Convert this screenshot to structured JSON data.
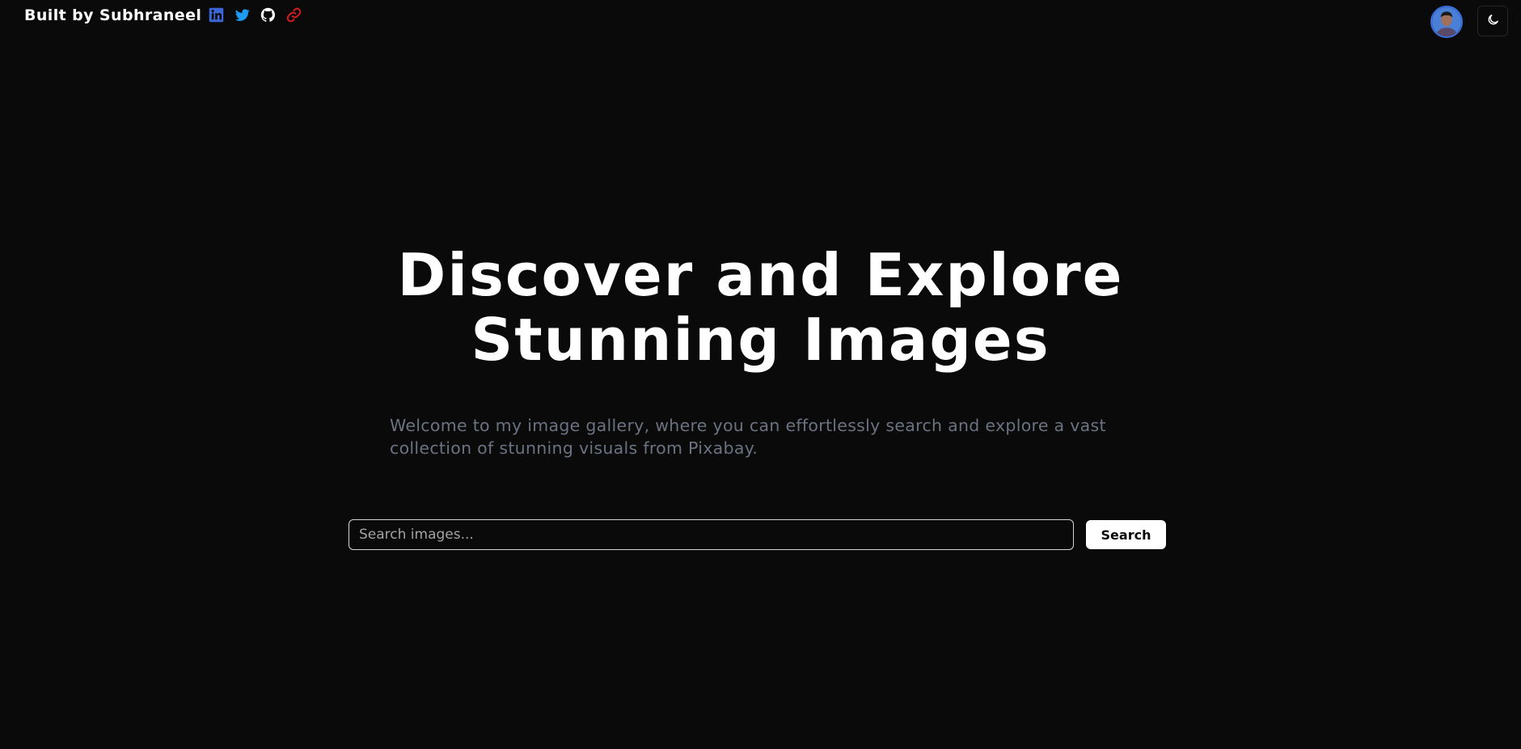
{
  "header": {
    "brand": "Built by Subhraneel",
    "socials": [
      {
        "icon": "linkedin-icon",
        "color": "#3b66d6"
      },
      {
        "icon": "twitter-icon",
        "color": "#1d9bf0"
      },
      {
        "icon": "github-icon",
        "color": "#ffffff"
      },
      {
        "icon": "link-icon",
        "color": "#c81e1e"
      }
    ],
    "avatar_icon": "avatar",
    "theme_toggle_icon": "moon-icon"
  },
  "hero": {
    "title_line1": "Discover and Explore",
    "title_line2": "Stunning Images",
    "subtitle": "Welcome to my image gallery, where you can effortlessly search and explore a vast collection of stunning visuals from Pixabay."
  },
  "search": {
    "value": "",
    "placeholder": "Search images...",
    "button_label": "Search"
  },
  "colors": {
    "background": "#0a0a0a",
    "text": "#ffffff",
    "subtitle": "#6b7280",
    "accent_button": "#ffffff"
  }
}
